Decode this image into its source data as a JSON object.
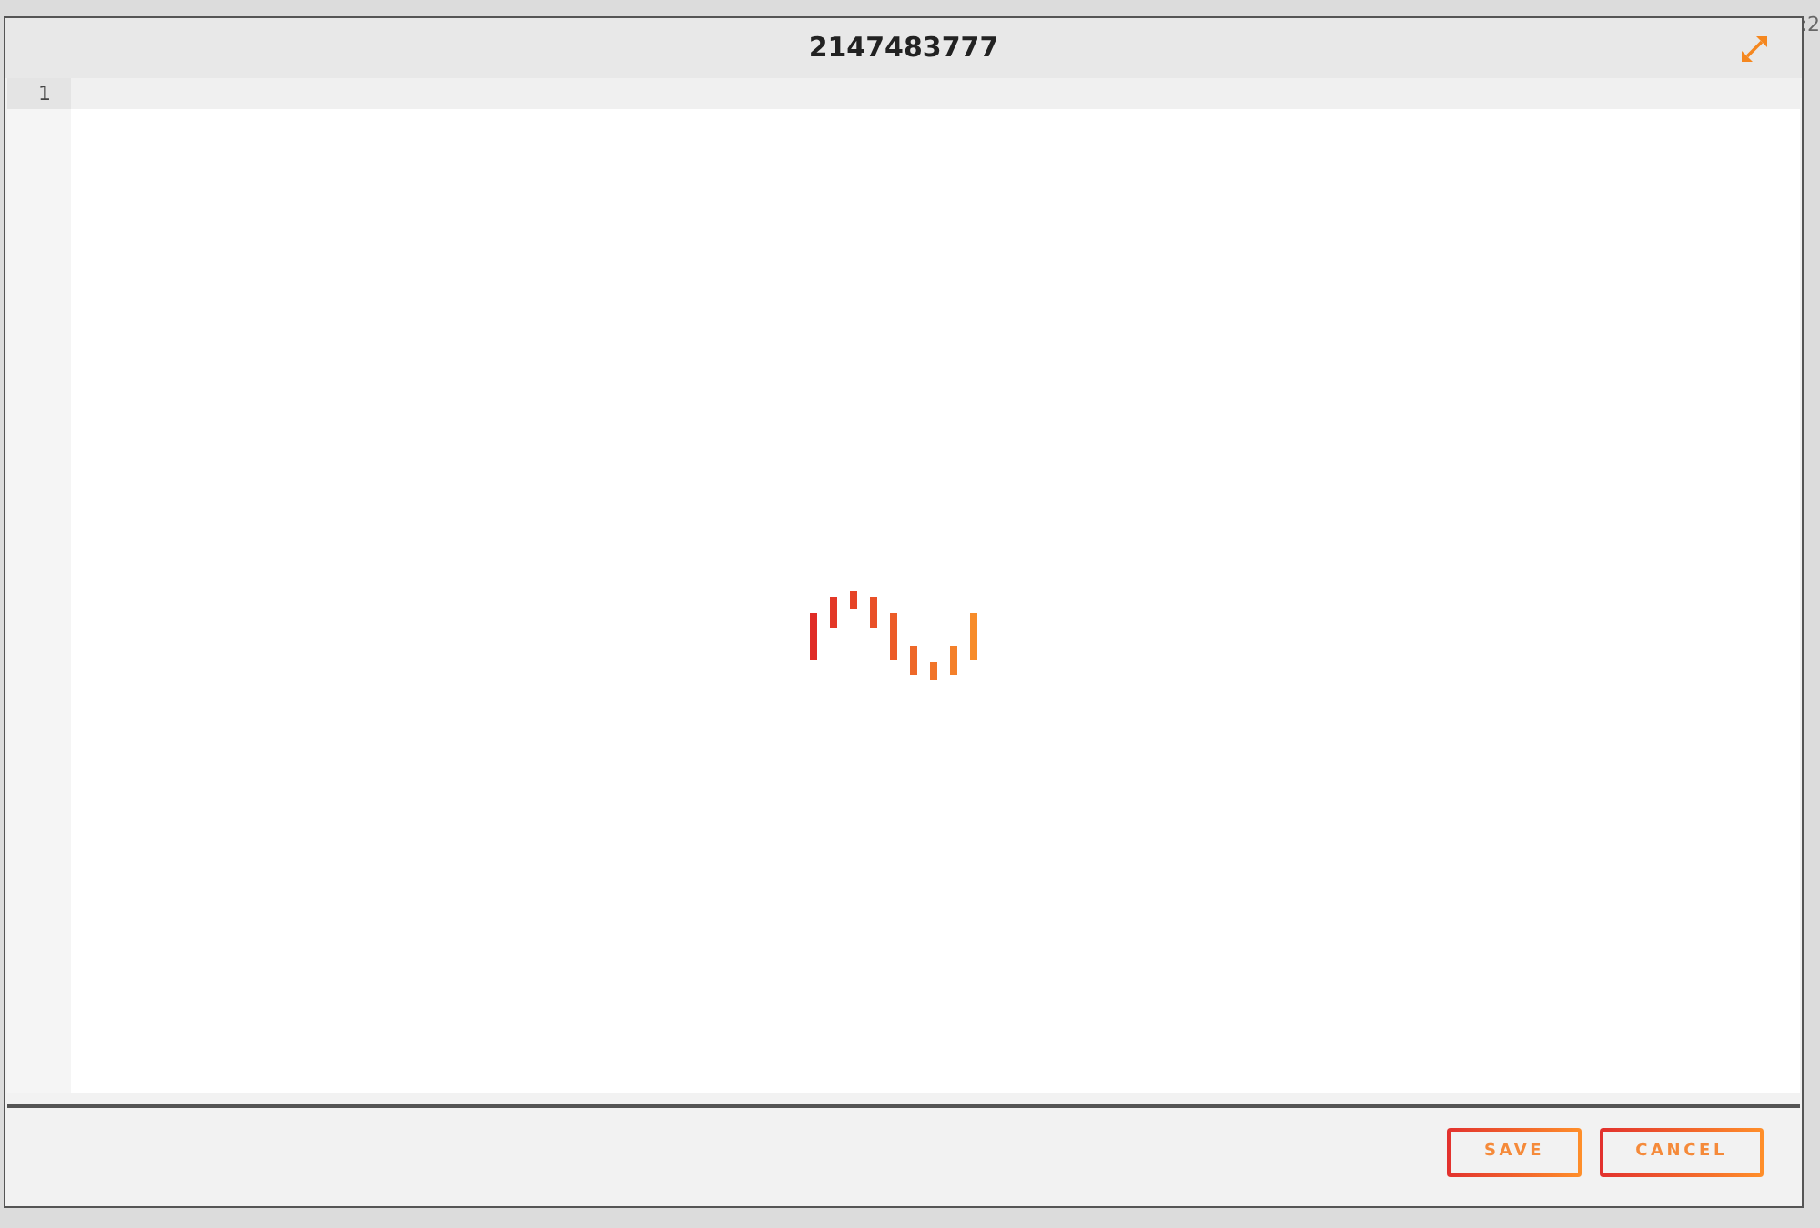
{
  "background_fragment": {
    "text": ":2"
  },
  "dialog": {
    "title": "2147483777",
    "editor": {
      "lines": [
        {
          "number": "1",
          "active": true
        }
      ],
      "loading": true
    },
    "buttons": [
      {
        "label": "SAVE"
      },
      {
        "label": "CANCEL"
      }
    ]
  }
}
